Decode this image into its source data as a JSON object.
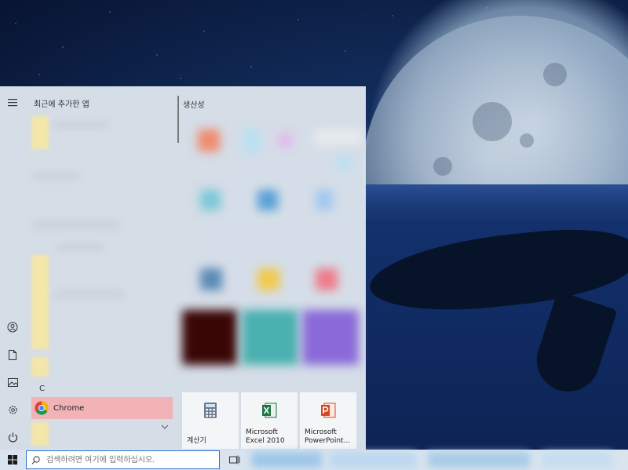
{
  "start_menu": {
    "recent_header": "최근에 추가한 앱",
    "letter_header": "C",
    "chrome_label": "Chrome",
    "tile_group_title": "생산성",
    "tiles": [
      {
        "label": "계산기",
        "icon": "calculator-icon"
      },
      {
        "label": "Microsoft Excel 2010",
        "icon": "excel-icon"
      },
      {
        "label": "Microsoft PowerPoint...",
        "icon": "powerpoint-icon"
      }
    ],
    "rail_icons": [
      "hamburger-menu-icon",
      "user-icon",
      "document-icon",
      "pictures-icon",
      "settings-icon",
      "power-icon"
    ]
  },
  "taskbar": {
    "search_placeholder": "검색하려면 여기에 입력하십시오."
  },
  "colors": {
    "chrome_highlight": "#f1b3b6",
    "search_border": "#2b73d6"
  }
}
